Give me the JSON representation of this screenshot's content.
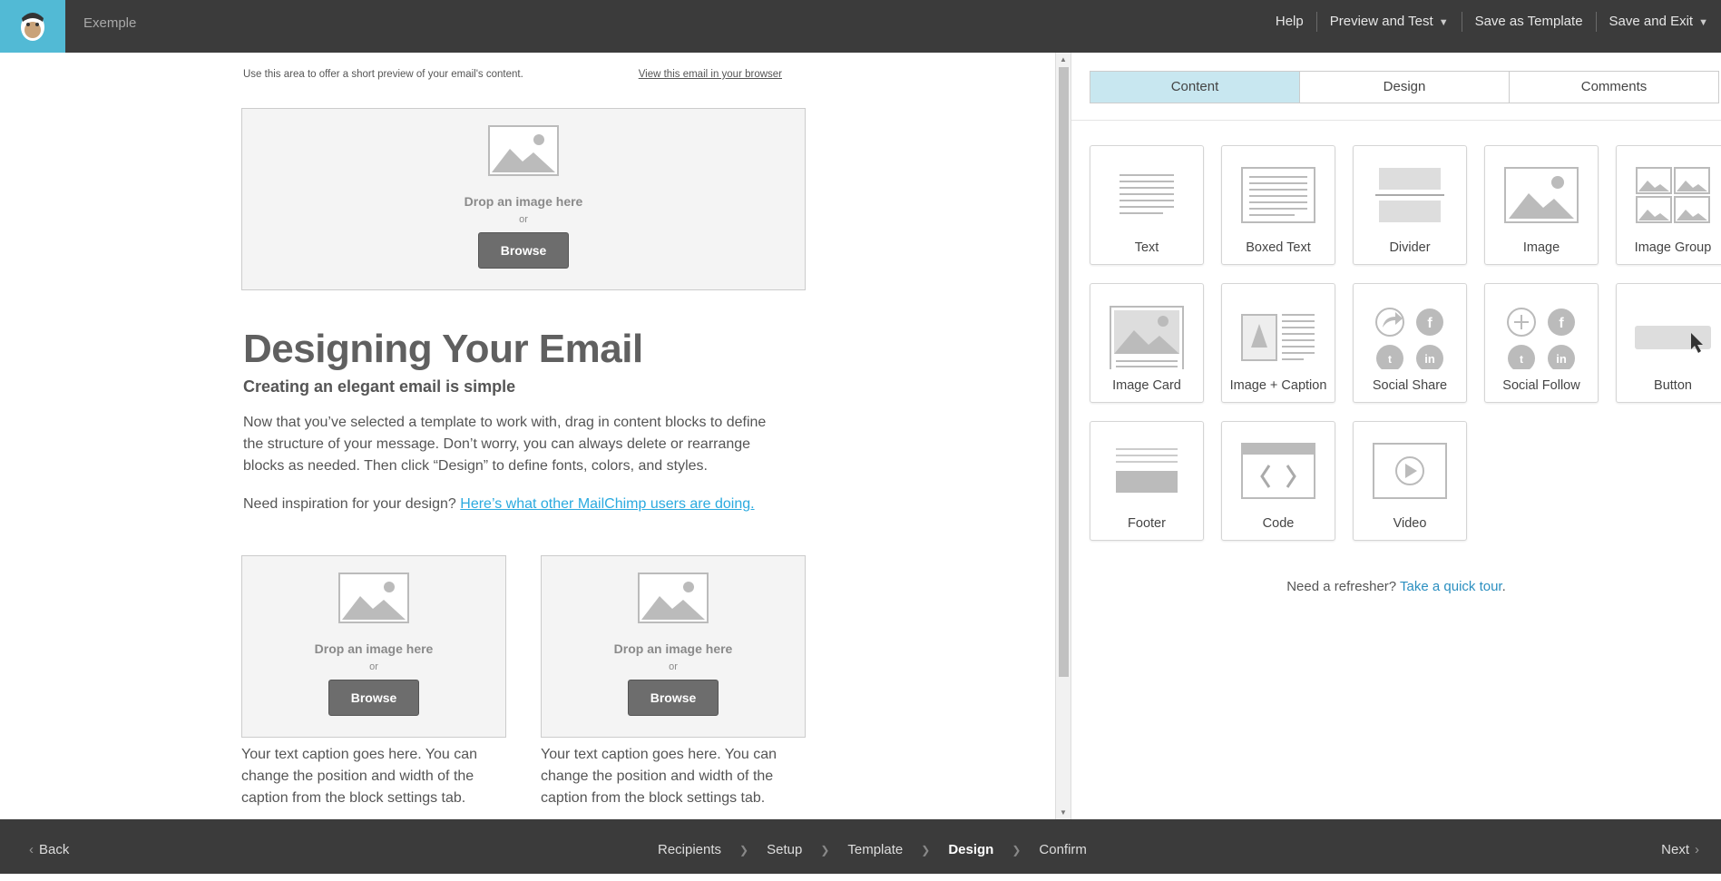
{
  "header": {
    "campaign_name": "Exemple",
    "actions": {
      "help": "Help",
      "preview": "Preview and Test",
      "save_template": "Save as Template",
      "save_exit": "Save and Exit"
    }
  },
  "email": {
    "preheader": "Use this area to offer a short preview of your email's content.",
    "view_in_browser": "View this email in your browser",
    "drop_text": "Drop an image here",
    "or_text": "or",
    "browse_label": "Browse",
    "heading": "Designing Your Email",
    "subheading": "Creating an elegant email is simple",
    "body": "Now that you’ve selected a template to work with, drag in content blocks to define the structure of your message. Don’t worry, you can always delete or rearrange blocks as needed. Then click “Design” to define fonts, colors, and styles.",
    "inspiration_prefix": "Need inspiration for your design?",
    "inspiration_link": "Here’s what other MailChimp users are doing.",
    "caption": "Your text caption goes here. You can change the position and width of the caption from the block settings tab."
  },
  "panel": {
    "tabs": [
      "Content",
      "Design",
      "Comments"
    ],
    "active_tab": "Content",
    "blocks": [
      {
        "label": "Text",
        "icon": "text-block-icon"
      },
      {
        "label": "Boxed Text",
        "icon": "boxed-text-block-icon"
      },
      {
        "label": "Divider",
        "icon": "divider-block-icon"
      },
      {
        "label": "Image",
        "icon": "image-block-icon"
      },
      {
        "label": "Image Group",
        "icon": "image-group-block-icon"
      },
      {
        "label": "Image Card",
        "icon": "image-card-block-icon"
      },
      {
        "label": "Image + Caption",
        "icon": "image-caption-block-icon"
      },
      {
        "label": "Social Share",
        "icon": "social-share-block-icon"
      },
      {
        "label": "Social Follow",
        "icon": "social-follow-block-icon"
      },
      {
        "label": "Button",
        "icon": "button-block-icon"
      },
      {
        "label": "Footer",
        "icon": "footer-block-icon"
      },
      {
        "label": "Code",
        "icon": "code-block-icon"
      },
      {
        "label": "Video",
        "icon": "video-block-icon"
      }
    ],
    "refresher_prefix": "Need a refresher?",
    "refresher_link": "Take a quick tour",
    "refresher_suffix": "."
  },
  "footer": {
    "back": "Back",
    "next": "Next",
    "steps": [
      "Recipients",
      "Setup",
      "Template",
      "Design",
      "Confirm"
    ],
    "current_step": "Design"
  },
  "colors": {
    "accent": "#52bad5",
    "dark_bar": "#3b3b3b",
    "link": "#2baadf",
    "active_tab": "#c8e7f0"
  }
}
